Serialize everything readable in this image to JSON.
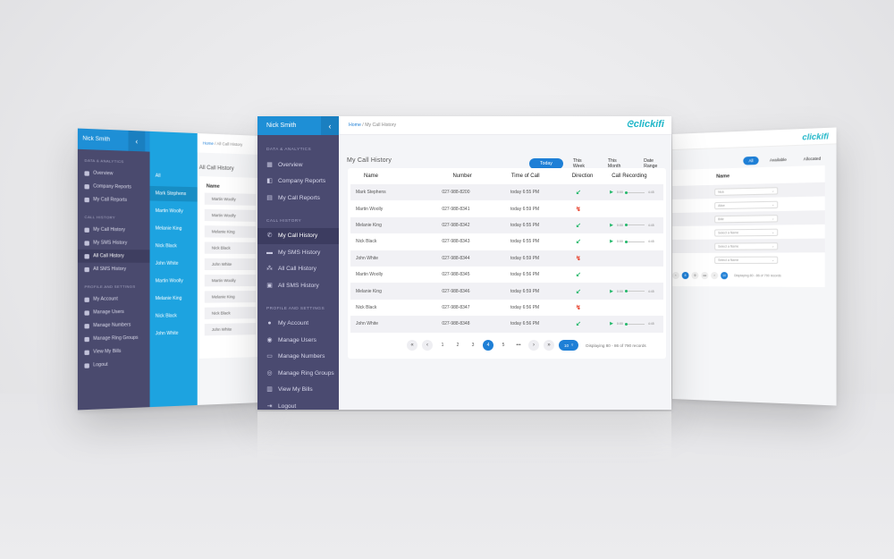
{
  "left_screen": {
    "user": "Nick Smith",
    "section_analytics": "DATA & ANALYTICS",
    "analytics_items": [
      "Overview",
      "Company Reports",
      "My Call Reports"
    ],
    "section_history": "CALL HISTORY",
    "history_items": [
      "My Call History",
      "My SMS History",
      "All Call History",
      "All SMS History"
    ],
    "section_profile": "PROFILE AND SETTINGS",
    "profile_items": [
      "My Account",
      "Manage Users",
      "Manage Numbers",
      "Manage Ring Groups",
      "View My Bills",
      "Logout"
    ],
    "names": [
      "All",
      "Mark Stephens",
      "Martin Woolly",
      "Melanie King",
      "Nick Black",
      "John White",
      "Martin Woolly",
      "Melanie King",
      "Nick Black",
      "John White"
    ],
    "breadcrumb_home": "Home",
    "breadcrumb_current": "All Call History",
    "title": "All Call History",
    "column": "Name",
    "rows": [
      "Martin Woolly",
      "Martin Woolly",
      "Melanie King",
      "Nick Black",
      "John White",
      "Martin Woolly",
      "Melanie King",
      "Nick Black",
      "John White"
    ]
  },
  "right_screen": {
    "logo": "clickifi",
    "filters": [
      "All",
      "Available",
      "Allocated"
    ],
    "column": "Name",
    "selects": [
      "Nick",
      "Alice",
      "Bille",
      "Select a Name",
      "Select a Name",
      "Select a Name"
    ],
    "pages": [
      "‹",
      "8",
      "9",
      "•••",
      "›"
    ],
    "page_size": "10",
    "info": "Displaying 80 - 86 of 790 records"
  },
  "main": {
    "user": "Nick Smith",
    "collapse_icon": "chevron-left-icon",
    "section_analytics": "DATA & ANALYTICS",
    "analytics_items": [
      {
        "label": "Overview",
        "icon": "▦"
      },
      {
        "label": "Company Reports",
        "icon": "◧"
      },
      {
        "label": "My Call Reports",
        "icon": "▤"
      }
    ],
    "section_history": "CALL HISTORY",
    "history_items": [
      {
        "label": "My Call History",
        "icon": "✆"
      },
      {
        "label": "My SMS History",
        "icon": "▬"
      },
      {
        "label": "All Call History",
        "icon": "⁂"
      },
      {
        "label": "All SMS History",
        "icon": "▣"
      }
    ],
    "section_profile": "PROFILE AND SETTINGS",
    "profile_items": [
      {
        "label": "My Account",
        "icon": "●"
      },
      {
        "label": "Manage Users",
        "icon": "◉"
      },
      {
        "label": "Manage Numbers",
        "icon": "▭"
      },
      {
        "label": "Manage Ring Groups",
        "icon": "◎"
      },
      {
        "label": "View My Bills",
        "icon": "▥"
      },
      {
        "label": "Logout",
        "icon": "⇥"
      }
    ],
    "breadcrumb_home": "Home",
    "breadcrumb_sep": "/",
    "breadcrumb_current": "My Call History",
    "logo": "clickifi",
    "page_title": "My Call History",
    "tabs": [
      "Today",
      "This Week",
      "This Month",
      "Date Range"
    ],
    "columns": [
      "Name",
      "Number",
      "Time of Call",
      "Direction",
      "Call Recording"
    ],
    "rows": [
      {
        "name": "Mark Stephens",
        "number": "027-988-8200",
        "time": "today 6:55 PM",
        "direction": "in",
        "rec": true,
        "t1": "0:00",
        "t2": "4:45"
      },
      {
        "name": "Martin Woolly",
        "number": "027-988-8341",
        "time": "today 6:59 PM",
        "direction": "miss",
        "rec": false
      },
      {
        "name": "Melanie King",
        "number": "027-988-8342",
        "time": "today 6:55 PM",
        "direction": "in",
        "rec": true,
        "t1": "0:00",
        "t2": "4:45"
      },
      {
        "name": "Nick Black",
        "number": "027-988-8343",
        "time": "today 6:55 PM",
        "direction": "in",
        "rec": true,
        "t1": "0:00",
        "t2": "4:45"
      },
      {
        "name": "John White",
        "number": "027-988-8344",
        "time": "today 6:59 PM",
        "direction": "miss",
        "rec": false
      },
      {
        "name": "Martin Woolly",
        "number": "027-988-8345",
        "time": "today 6:56 PM",
        "direction": "in",
        "rec": false
      },
      {
        "name": "Melanie King",
        "number": "027-988-8346",
        "time": "today 6:59 PM",
        "direction": "in",
        "rec": true,
        "t1": "0:00",
        "t2": "4:45"
      },
      {
        "name": "Nick Black",
        "number": "027-988-8347",
        "time": "today 6:56 PM",
        "direction": "miss",
        "rec": false
      },
      {
        "name": "John White",
        "number": "027-988-8348",
        "time": "today 6:56 PM",
        "direction": "in",
        "rec": true,
        "t1": "0:00",
        "t2": "4:45"
      }
    ],
    "pager": {
      "first": "«",
      "prev": "‹",
      "pages": [
        "1",
        "2",
        "3",
        "4",
        "5",
        "•••"
      ],
      "active_page": "4",
      "next": "›",
      "last": "»",
      "page_size": "10",
      "page_size_caret": "▿",
      "info": "Displaying 80 - 86 of 790 records"
    }
  },
  "colors": {
    "sidebar": "#4a4a70",
    "accent": "#1e7fd6",
    "names_panel": "#1da3e0",
    "logo": "#1fb6c8",
    "incoming": "#22b86a",
    "missed": "#e8432e"
  }
}
